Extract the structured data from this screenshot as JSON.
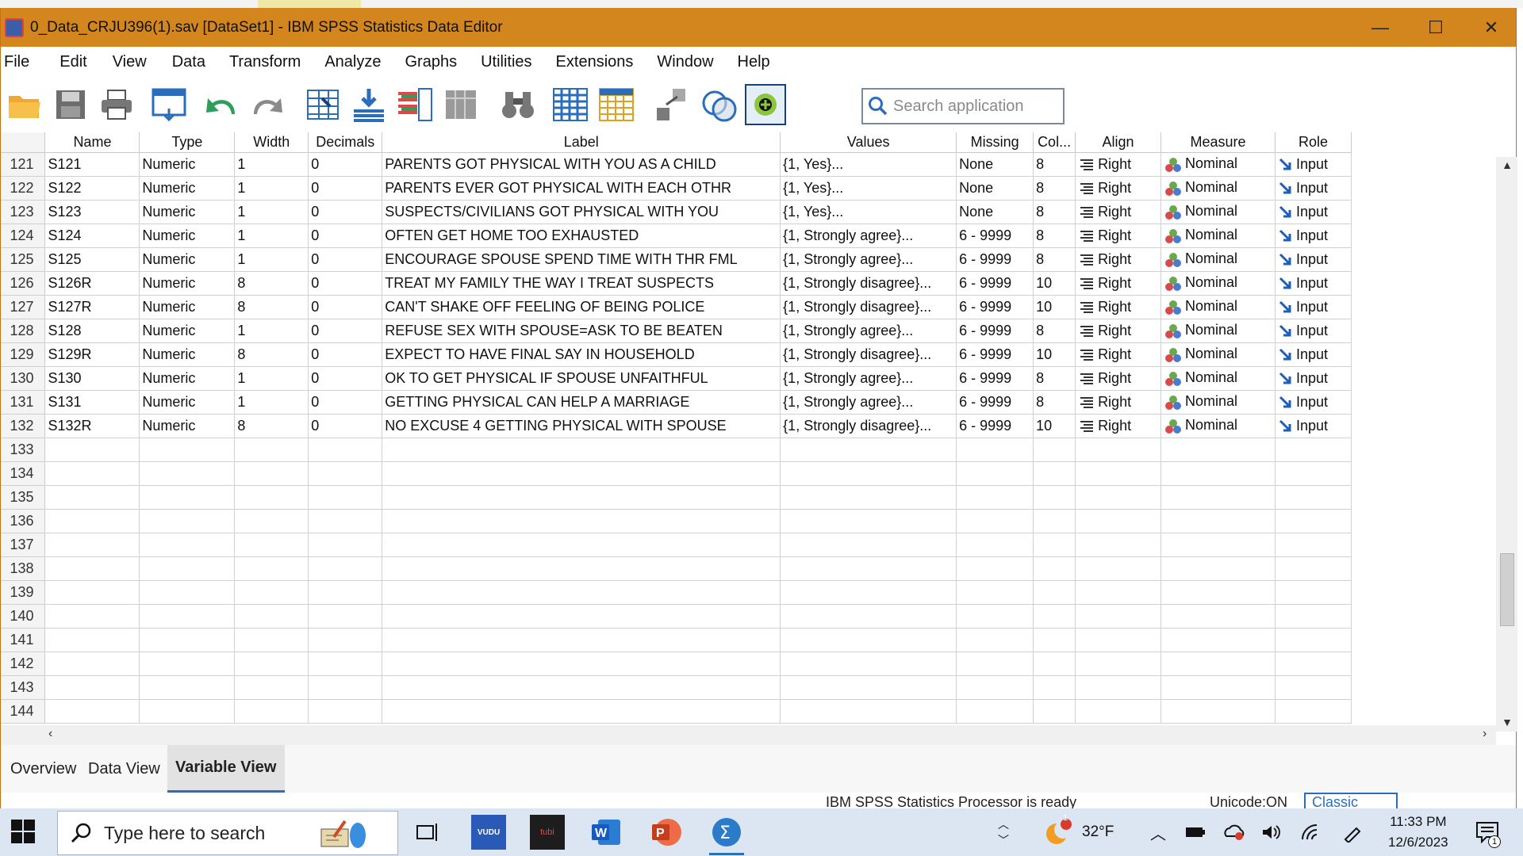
{
  "window": {
    "title": "0_Data_CRJU396(1).sav [DataSet1] - IBM SPSS Statistics Data Editor",
    "min": "—",
    "max": "☐",
    "close": "✕"
  },
  "menu": [
    "File",
    "Edit",
    "View",
    "Data",
    "Transform",
    "Analyze",
    "Graphs",
    "Utilities",
    "Extensions",
    "Window",
    "Help"
  ],
  "search": {
    "placeholder": "Search application"
  },
  "columns": [
    "Name",
    "Type",
    "Width",
    "Decimals",
    "Label",
    "Values",
    "Missing",
    "Col...",
    "Align",
    "Measure",
    "Role"
  ],
  "rows": [
    {
      "n": "121",
      "name": "S121",
      "type": "Numeric",
      "width": "1",
      "dec": "0",
      "label": "PARENTS GOT PHYSICAL WITH YOU AS A CHILD",
      "values": "{1, Yes}...",
      "missing": "None",
      "col": "8",
      "align": "Right",
      "measure": "Nominal",
      "role": "Input"
    },
    {
      "n": "122",
      "name": "S122",
      "type": "Numeric",
      "width": "1",
      "dec": "0",
      "label": "PARENTS EVER GOT PHYSICAL WITH EACH OTHR",
      "values": "{1, Yes}...",
      "missing": "None",
      "col": "8",
      "align": "Right",
      "measure": "Nominal",
      "role": "Input"
    },
    {
      "n": "123",
      "name": "S123",
      "type": "Numeric",
      "width": "1",
      "dec": "0",
      "label": "SUSPECTS/CIVILIANS GOT PHYSICAL WITH YOU",
      "values": "{1, Yes}...",
      "missing": "None",
      "col": "8",
      "align": "Right",
      "measure": "Nominal",
      "role": "Input"
    },
    {
      "n": "124",
      "name": "S124",
      "type": "Numeric",
      "width": "1",
      "dec": "0",
      "label": "OFTEN GET HOME TOO EXHAUSTED",
      "values": "{1, Strongly agree}...",
      "missing": "6 - 9999",
      "col": "8",
      "align": "Right",
      "measure": "Nominal",
      "role": "Input"
    },
    {
      "n": "125",
      "name": "S125",
      "type": "Numeric",
      "width": "1",
      "dec": "0",
      "label": "ENCOURAGE SPOUSE SPEND TIME WITH THR FML",
      "values": "{1, Strongly agree}...",
      "missing": "6 - 9999",
      "col": "8",
      "align": "Right",
      "measure": "Nominal",
      "role": "Input"
    },
    {
      "n": "126",
      "name": "S126R",
      "type": "Numeric",
      "width": "8",
      "dec": "0",
      "label": "TREAT MY FAMILY THE WAY I TREAT SUSPECTS",
      "values": "{1, Strongly disagree}...",
      "missing": "6 - 9999",
      "col": "10",
      "align": "Right",
      "measure": "Nominal",
      "role": "Input"
    },
    {
      "n": "127",
      "name": "S127R",
      "type": "Numeric",
      "width": "8",
      "dec": "0",
      "label": "CAN'T SHAKE OFF FEELING OF BEING POLICE",
      "values": "{1, Strongly disagree}...",
      "missing": "6 - 9999",
      "col": "10",
      "align": "Right",
      "measure": "Nominal",
      "role": "Input"
    },
    {
      "n": "128",
      "name": "S128",
      "type": "Numeric",
      "width": "1",
      "dec": "0",
      "label": "REFUSE SEX WITH SPOUSE=ASK TO BE BEATEN",
      "values": "{1, Strongly agree}...",
      "missing": "6 - 9999",
      "col": "8",
      "align": "Right",
      "measure": "Nominal",
      "role": "Input"
    },
    {
      "n": "129",
      "name": "S129R",
      "type": "Numeric",
      "width": "8",
      "dec": "0",
      "label": "EXPECT TO HAVE FINAL SAY IN HOUSEHOLD",
      "values": "{1, Strongly disagree}...",
      "missing": "6 - 9999",
      "col": "10",
      "align": "Right",
      "measure": "Nominal",
      "role": "Input"
    },
    {
      "n": "130",
      "name": "S130",
      "type": "Numeric",
      "width": "1",
      "dec": "0",
      "label": "OK TO GET PHYSICAL IF SPOUSE UNFAITHFUL",
      "values": "{1, Strongly agree}...",
      "missing": "6 - 9999",
      "col": "8",
      "align": "Right",
      "measure": "Nominal",
      "role": "Input"
    },
    {
      "n": "131",
      "name": "S131",
      "type": "Numeric",
      "width": "1",
      "dec": "0",
      "label": "GETTING PHYSICAL CAN HELP A MARRIAGE",
      "values": "{1, Strongly agree}...",
      "missing": "6 - 9999",
      "col": "8",
      "align": "Right",
      "measure": "Nominal",
      "role": "Input"
    },
    {
      "n": "132",
      "name": "S132R",
      "type": "Numeric",
      "width": "8",
      "dec": "0",
      "label": "NO EXCUSE 4 GETTING PHYSICAL WITH SPOUSE",
      "values": "{1, Strongly disagree}...",
      "missing": "6 - 9999",
      "col": "10",
      "align": "Right",
      "measure": "Nominal",
      "role": "Input"
    }
  ],
  "empty_rows": [
    "133",
    "134",
    "135",
    "136",
    "137",
    "138",
    "139",
    "140",
    "141",
    "142",
    "143",
    "144"
  ],
  "tabs": [
    "Overview",
    "Data View",
    "Variable View"
  ],
  "status": {
    "processor": "IBM SPSS Statistics Processor is ready",
    "unicode": "Unicode:ON",
    "classic": "Classic"
  },
  "taskbar": {
    "search_placeholder": "Type here to search",
    "weather": "32°F",
    "weather_badge": "1",
    "time": "11:33 PM",
    "date": "12/6/2023",
    "notif": "1",
    "apps": [
      "task-view-icon",
      "vudu-icon",
      "tubi-icon",
      "word-icon",
      "powerpoint-icon",
      "spss-icon"
    ]
  },
  "colors": {
    "titlebar": "#d3861e",
    "accent": "#2a6ebb",
    "taskbar": "#dce6f2"
  }
}
